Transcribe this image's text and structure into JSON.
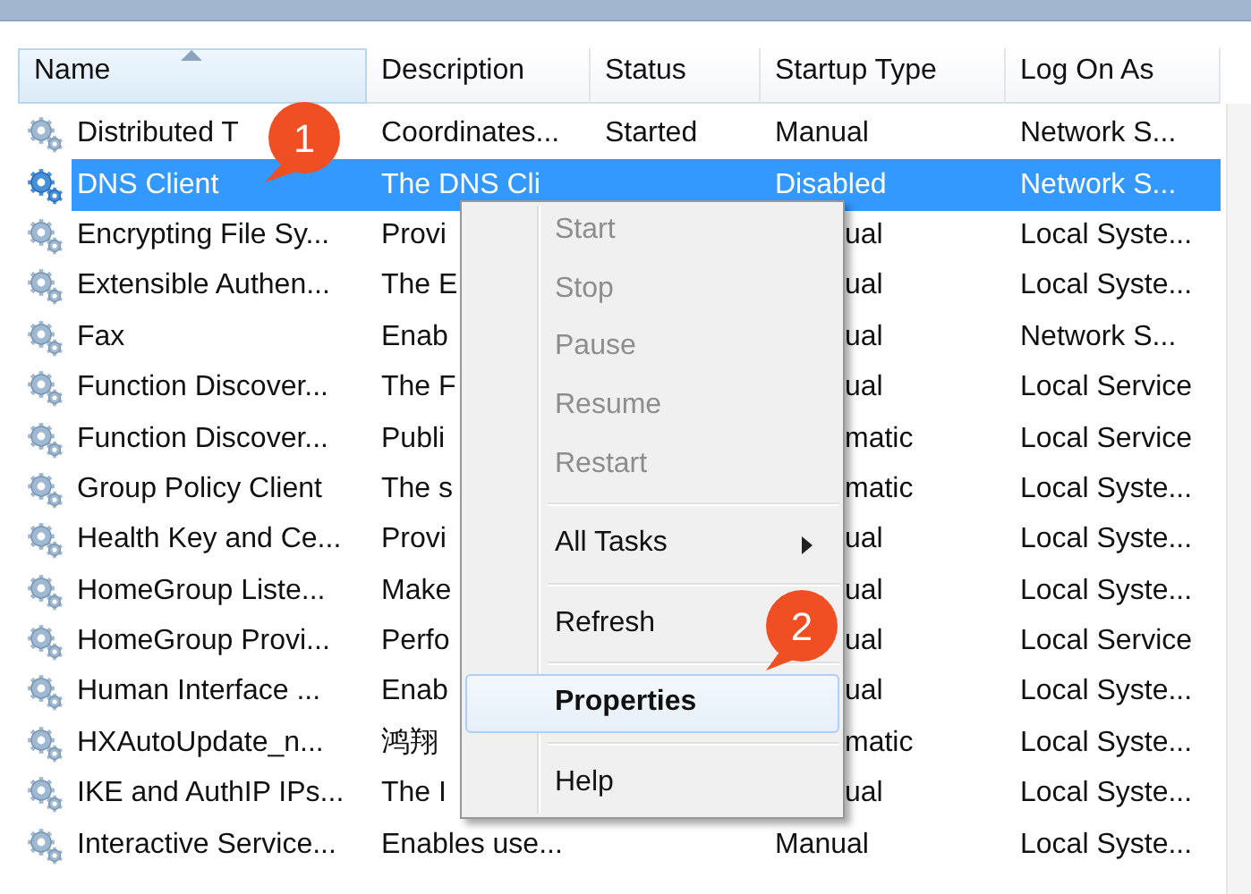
{
  "table": {
    "columns": [
      {
        "label": "Name",
        "sorted": true
      },
      {
        "label": "Description",
        "sorted": false
      },
      {
        "label": "Status",
        "sorted": false
      },
      {
        "label": "Startup Type",
        "sorted": false
      },
      {
        "label": "Log On As",
        "sorted": false
      }
    ],
    "rows": [
      {
        "name": "Distributed T",
        "description": "Coordinates...",
        "status": "Started",
        "startup_type": "Manual",
        "log_on_as": "Network S...",
        "selected": false,
        "under_menu": false
      },
      {
        "name": "DNS Client",
        "description": "The DNS Cli",
        "startup_type": "Disabled",
        "log_on_as": "Network S...",
        "selected": true,
        "under_menu": false
      },
      {
        "name": "Encrypting File Sy...",
        "description": "Provi",
        "startup_type": "ual",
        "log_on_as": "Local Syste...",
        "selected": false,
        "under_menu": true
      },
      {
        "name": "Extensible Authen...",
        "description": "The E",
        "startup_type": "ual",
        "log_on_as": "Local Syste...",
        "selected": false,
        "under_menu": true
      },
      {
        "name": "Fax",
        "description": "Enab",
        "startup_type": "ual",
        "log_on_as": "Network S...",
        "selected": false,
        "under_menu": true
      },
      {
        "name": "Function Discover...",
        "description": "The F",
        "startup_type": "ual",
        "log_on_as": "Local Service",
        "selected": false,
        "under_menu": true
      },
      {
        "name": "Function Discover...",
        "description": "Publi",
        "startup_type": "matic",
        "log_on_as": "Local Service",
        "selected": false,
        "under_menu": true
      },
      {
        "name": "Group Policy Client",
        "description": "The s",
        "startup_type": "matic",
        "log_on_as": "Local Syste...",
        "selected": false,
        "under_menu": true
      },
      {
        "name": "Health Key and Ce...",
        "description": "Provi",
        "startup_type": "ual",
        "log_on_as": "Local Syste...",
        "selected": false,
        "under_menu": true
      },
      {
        "name": "HomeGroup Liste...",
        "description": "Make",
        "startup_type": "ual",
        "log_on_as": "Local Syste...",
        "selected": false,
        "under_menu": true
      },
      {
        "name": "HomeGroup Provi...",
        "description": "Perfo",
        "startup_type": "ual",
        "log_on_as": "Local Service",
        "selected": false,
        "under_menu": true
      },
      {
        "name": "Human Interface ...",
        "description": "Enab",
        "startup_type": "ual",
        "log_on_as": "Local Syste...",
        "selected": false,
        "under_menu": true
      },
      {
        "name": "HXAutoUpdate_n...",
        "description": "鸿翔",
        "startup_type": "matic",
        "log_on_as": "Local Syste...",
        "selected": false,
        "under_menu": true
      },
      {
        "name": "IKE and AuthIP IPs...",
        "description": "The I",
        "startup_type": "ual",
        "log_on_as": "Local Syste...",
        "selected": false,
        "under_menu": true
      },
      {
        "name": "Interactive Service...",
        "description": "Enables use...",
        "startup_type": "Manual",
        "log_on_as": "Local Syste...",
        "selected": false,
        "under_menu": false
      }
    ]
  },
  "context_menu": {
    "items": [
      {
        "kind": "item",
        "label": "Start",
        "disabled": true,
        "selected": false,
        "default": false,
        "submenu": false
      },
      {
        "kind": "item",
        "label": "Stop",
        "disabled": true,
        "selected": false,
        "default": false,
        "submenu": false
      },
      {
        "kind": "item",
        "label": "Pause",
        "disabled": true,
        "selected": false,
        "default": false,
        "submenu": false
      },
      {
        "kind": "item",
        "label": "Resume",
        "disabled": true,
        "selected": false,
        "default": false,
        "submenu": false
      },
      {
        "kind": "item",
        "label": "Restart",
        "disabled": true,
        "selected": false,
        "default": false,
        "submenu": false
      },
      {
        "kind": "separator"
      },
      {
        "kind": "item",
        "label": "All Tasks",
        "disabled": false,
        "selected": false,
        "default": false,
        "submenu": true
      },
      {
        "kind": "separator"
      },
      {
        "kind": "item",
        "label": "Refresh",
        "disabled": false,
        "selected": false,
        "default": false,
        "submenu": false
      },
      {
        "kind": "separator"
      },
      {
        "kind": "item",
        "label": "Properties",
        "disabled": false,
        "selected": true,
        "default": true,
        "submenu": false
      },
      {
        "kind": "separator"
      },
      {
        "kind": "item",
        "label": "Help",
        "disabled": false,
        "selected": false,
        "default": false,
        "submenu": false
      }
    ]
  },
  "callouts": [
    {
      "label": "1"
    },
    {
      "label": "2"
    }
  ]
}
